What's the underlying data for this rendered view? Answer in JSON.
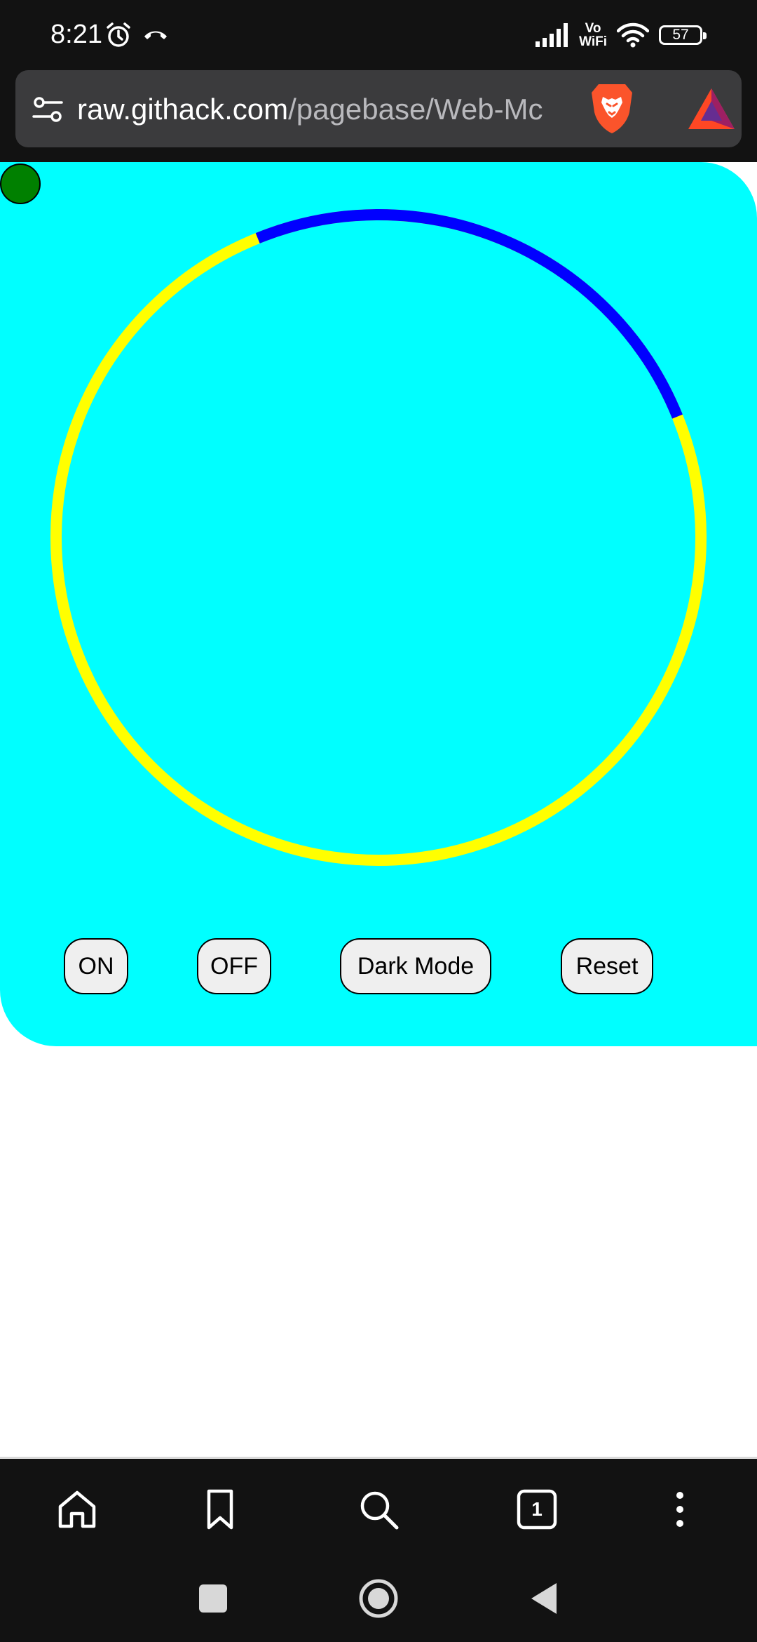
{
  "status_bar": {
    "time": "8:21",
    "alarm_icon": "alarm-clock-icon",
    "call_icon": "missed-call-icon",
    "signal_icon": "cellular-signal-icon",
    "vowifi_line1": "Vo",
    "vowifi_line2": "WiFi",
    "wifi_icon": "wifi-icon",
    "battery_level": "57"
  },
  "browser": {
    "url_host": "raw.githack.com",
    "url_path": "/pagebase/Web-Mc",
    "site_settings_icon": "site-settings-icon",
    "shield_icon": "brave-shields-icon",
    "rewards_icon": "brave-rewards-icon"
  },
  "page": {
    "background_color": "#00ffff",
    "ring": {
      "track_color": "#ffff00",
      "progress_color": "#0000ff",
      "progress_start_clock_deg": -22,
      "progress_end_clock_deg": 68
    },
    "indicator_color": "#008000",
    "buttons": {
      "on": "ON",
      "off": "OFF",
      "dark_mode": "Dark Mode",
      "reset": "Reset"
    }
  },
  "bottom_nav": {
    "home_icon": "home-icon",
    "bookmark_icon": "bookmark-icon",
    "search_icon": "search-icon",
    "tabs_count": "1",
    "menu_icon": "more-vertical-icon"
  },
  "system_nav": {
    "recents_icon": "recents-square-icon",
    "home_icon": "home-circle-icon",
    "back_icon": "back-triangle-icon"
  }
}
